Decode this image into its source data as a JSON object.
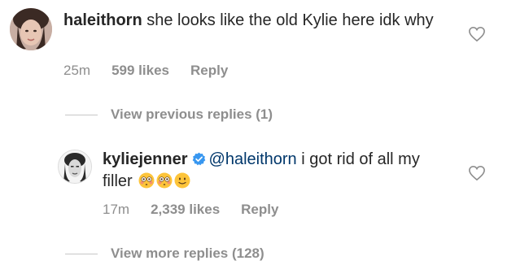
{
  "comments": [
    {
      "username": "haleithorn",
      "text": " she looks like the old Kylie here idk why",
      "time": "25m",
      "likes": "599 likes",
      "reply_label": "Reply"
    },
    {
      "username": "kyliejenner",
      "verified": true,
      "mention": "@haleithorn",
      "text": " i got rid of all my filler",
      "emojis": [
        "flushed-face",
        "flushed-face",
        "slightly-smiling-face"
      ],
      "time": "17m",
      "likes": "2,339 likes",
      "reply_label": "Reply"
    }
  ],
  "view_previous": "View previous replies (1)",
  "view_more": "View more replies (128)",
  "colors": {
    "text": "#262626",
    "muted": "#8e8e8e",
    "mention": "#00376b",
    "verified": "#3897f0"
  }
}
